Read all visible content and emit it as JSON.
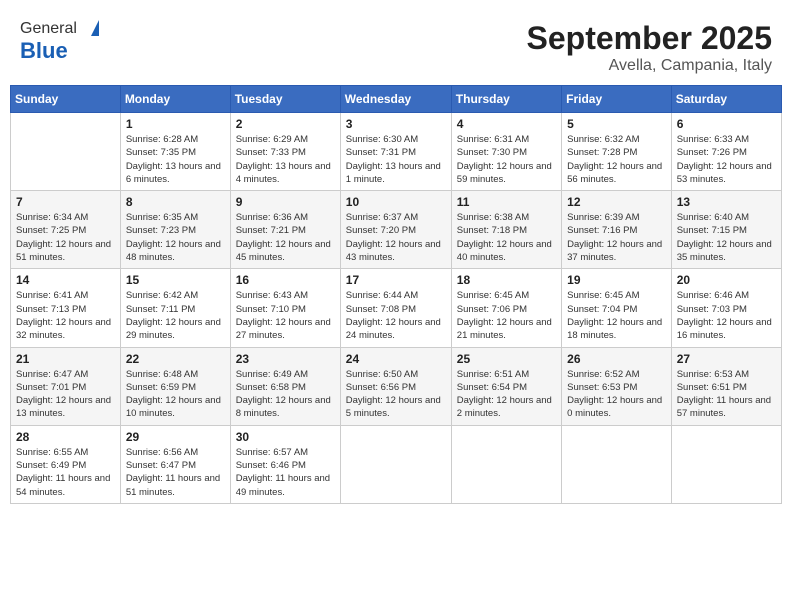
{
  "header": {
    "logo_general": "General",
    "logo_blue": "Blue",
    "month": "September 2025",
    "location": "Avella, Campania, Italy"
  },
  "days_of_week": [
    "Sunday",
    "Monday",
    "Tuesday",
    "Wednesday",
    "Thursday",
    "Friday",
    "Saturday"
  ],
  "weeks": [
    [
      {
        "day": "",
        "sunrise": "",
        "sunset": "",
        "daylight": ""
      },
      {
        "day": "1",
        "sunrise": "Sunrise: 6:28 AM",
        "sunset": "Sunset: 7:35 PM",
        "daylight": "Daylight: 13 hours and 6 minutes."
      },
      {
        "day": "2",
        "sunrise": "Sunrise: 6:29 AM",
        "sunset": "Sunset: 7:33 PM",
        "daylight": "Daylight: 13 hours and 4 minutes."
      },
      {
        "day": "3",
        "sunrise": "Sunrise: 6:30 AM",
        "sunset": "Sunset: 7:31 PM",
        "daylight": "Daylight: 13 hours and 1 minute."
      },
      {
        "day": "4",
        "sunrise": "Sunrise: 6:31 AM",
        "sunset": "Sunset: 7:30 PM",
        "daylight": "Daylight: 12 hours and 59 minutes."
      },
      {
        "day": "5",
        "sunrise": "Sunrise: 6:32 AM",
        "sunset": "Sunset: 7:28 PM",
        "daylight": "Daylight: 12 hours and 56 minutes."
      },
      {
        "day": "6",
        "sunrise": "Sunrise: 6:33 AM",
        "sunset": "Sunset: 7:26 PM",
        "daylight": "Daylight: 12 hours and 53 minutes."
      }
    ],
    [
      {
        "day": "7",
        "sunrise": "Sunrise: 6:34 AM",
        "sunset": "Sunset: 7:25 PM",
        "daylight": "Daylight: 12 hours and 51 minutes."
      },
      {
        "day": "8",
        "sunrise": "Sunrise: 6:35 AM",
        "sunset": "Sunset: 7:23 PM",
        "daylight": "Daylight: 12 hours and 48 minutes."
      },
      {
        "day": "9",
        "sunrise": "Sunrise: 6:36 AM",
        "sunset": "Sunset: 7:21 PM",
        "daylight": "Daylight: 12 hours and 45 minutes."
      },
      {
        "day": "10",
        "sunrise": "Sunrise: 6:37 AM",
        "sunset": "Sunset: 7:20 PM",
        "daylight": "Daylight: 12 hours and 43 minutes."
      },
      {
        "day": "11",
        "sunrise": "Sunrise: 6:38 AM",
        "sunset": "Sunset: 7:18 PM",
        "daylight": "Daylight: 12 hours and 40 minutes."
      },
      {
        "day": "12",
        "sunrise": "Sunrise: 6:39 AM",
        "sunset": "Sunset: 7:16 PM",
        "daylight": "Daylight: 12 hours and 37 minutes."
      },
      {
        "day": "13",
        "sunrise": "Sunrise: 6:40 AM",
        "sunset": "Sunset: 7:15 PM",
        "daylight": "Daylight: 12 hours and 35 minutes."
      }
    ],
    [
      {
        "day": "14",
        "sunrise": "Sunrise: 6:41 AM",
        "sunset": "Sunset: 7:13 PM",
        "daylight": "Daylight: 12 hours and 32 minutes."
      },
      {
        "day": "15",
        "sunrise": "Sunrise: 6:42 AM",
        "sunset": "Sunset: 7:11 PM",
        "daylight": "Daylight: 12 hours and 29 minutes."
      },
      {
        "day": "16",
        "sunrise": "Sunrise: 6:43 AM",
        "sunset": "Sunset: 7:10 PM",
        "daylight": "Daylight: 12 hours and 27 minutes."
      },
      {
        "day": "17",
        "sunrise": "Sunrise: 6:44 AM",
        "sunset": "Sunset: 7:08 PM",
        "daylight": "Daylight: 12 hours and 24 minutes."
      },
      {
        "day": "18",
        "sunrise": "Sunrise: 6:45 AM",
        "sunset": "Sunset: 7:06 PM",
        "daylight": "Daylight: 12 hours and 21 minutes."
      },
      {
        "day": "19",
        "sunrise": "Sunrise: 6:45 AM",
        "sunset": "Sunset: 7:04 PM",
        "daylight": "Daylight: 12 hours and 18 minutes."
      },
      {
        "day": "20",
        "sunrise": "Sunrise: 6:46 AM",
        "sunset": "Sunset: 7:03 PM",
        "daylight": "Daylight: 12 hours and 16 minutes."
      }
    ],
    [
      {
        "day": "21",
        "sunrise": "Sunrise: 6:47 AM",
        "sunset": "Sunset: 7:01 PM",
        "daylight": "Daylight: 12 hours and 13 minutes."
      },
      {
        "day": "22",
        "sunrise": "Sunrise: 6:48 AM",
        "sunset": "Sunset: 6:59 PM",
        "daylight": "Daylight: 12 hours and 10 minutes."
      },
      {
        "day": "23",
        "sunrise": "Sunrise: 6:49 AM",
        "sunset": "Sunset: 6:58 PM",
        "daylight": "Daylight: 12 hours and 8 minutes."
      },
      {
        "day": "24",
        "sunrise": "Sunrise: 6:50 AM",
        "sunset": "Sunset: 6:56 PM",
        "daylight": "Daylight: 12 hours and 5 minutes."
      },
      {
        "day": "25",
        "sunrise": "Sunrise: 6:51 AM",
        "sunset": "Sunset: 6:54 PM",
        "daylight": "Daylight: 12 hours and 2 minutes."
      },
      {
        "day": "26",
        "sunrise": "Sunrise: 6:52 AM",
        "sunset": "Sunset: 6:53 PM",
        "daylight": "Daylight: 12 hours and 0 minutes."
      },
      {
        "day": "27",
        "sunrise": "Sunrise: 6:53 AM",
        "sunset": "Sunset: 6:51 PM",
        "daylight": "Daylight: 11 hours and 57 minutes."
      }
    ],
    [
      {
        "day": "28",
        "sunrise": "Sunrise: 6:55 AM",
        "sunset": "Sunset: 6:49 PM",
        "daylight": "Daylight: 11 hours and 54 minutes."
      },
      {
        "day": "29",
        "sunrise": "Sunrise: 6:56 AM",
        "sunset": "Sunset: 6:47 PM",
        "daylight": "Daylight: 11 hours and 51 minutes."
      },
      {
        "day": "30",
        "sunrise": "Sunrise: 6:57 AM",
        "sunset": "Sunset: 6:46 PM",
        "daylight": "Daylight: 11 hours and 49 minutes."
      },
      {
        "day": "",
        "sunrise": "",
        "sunset": "",
        "daylight": ""
      },
      {
        "day": "",
        "sunrise": "",
        "sunset": "",
        "daylight": ""
      },
      {
        "day": "",
        "sunrise": "",
        "sunset": "",
        "daylight": ""
      },
      {
        "day": "",
        "sunrise": "",
        "sunset": "",
        "daylight": ""
      }
    ]
  ]
}
